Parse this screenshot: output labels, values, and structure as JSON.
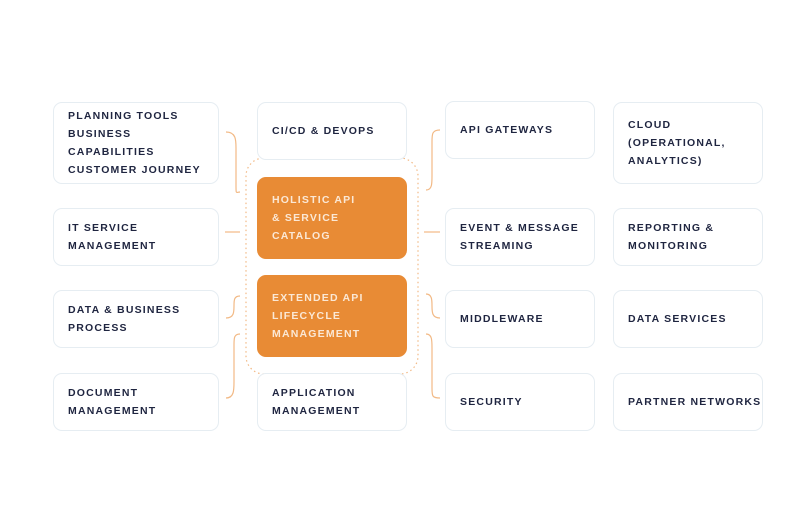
{
  "diagram": {
    "left_column": [
      {
        "label": "PLANNING TOOLS\nBUSINESS CAPABILITIES\nCUSTOMER JOURNEY"
      },
      {
        "label": "IT SERVICE\nMANAGEMENT"
      },
      {
        "label": "DATA & BUSINESS\nPROCESS"
      },
      {
        "label": "DOCUMENT\nMANAGEMENT"
      }
    ],
    "center_column": {
      "top": {
        "label": "CI/CD & DEVOPS"
      },
      "core": [
        {
          "label": "HOLISTIC API\n& SERVICE\nCATALOG"
        },
        {
          "label": "EXTENDED API\nLIFECYCLE\nMANAGEMENT"
        }
      ],
      "bottom": {
        "label": "APPLICATION\nMANAGEMENT"
      }
    },
    "right_inner_column": [
      {
        "label": "API GATEWAYS"
      },
      {
        "label": "EVENT & MESSAGE\nSTREAMING"
      },
      {
        "label": "MIDDLEWARE"
      },
      {
        "label": "SECURITY"
      }
    ],
    "right_outer_column": [
      {
        "label": "CLOUD\n(OPERATIONAL,\nANALYTICS)"
      },
      {
        "label": "REPORTING &\nMONITORING"
      },
      {
        "label": "DATA SERVICES"
      },
      {
        "label": "PARTNER NETWORKS"
      }
    ],
    "colors": {
      "accent": "#e88b35",
      "connector": "#f2b985",
      "text": "#1f2540",
      "border": "#e6edf2"
    }
  }
}
